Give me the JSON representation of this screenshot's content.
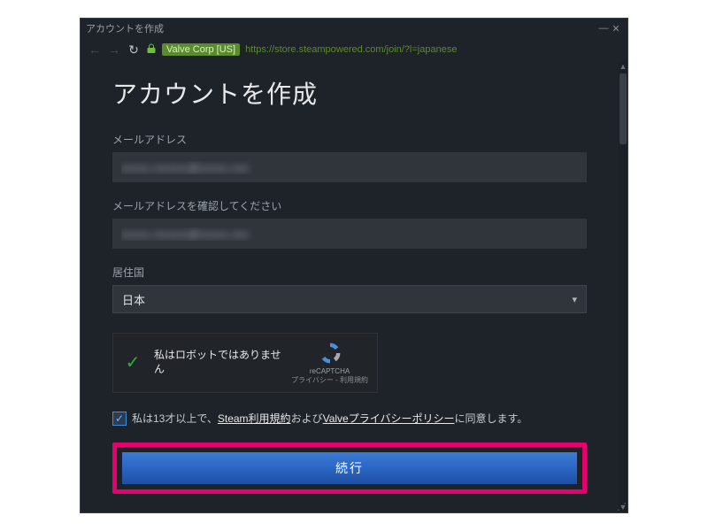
{
  "window": {
    "title": "アカウントを作成"
  },
  "toolbar": {
    "badge": "Valve Corp [US]",
    "url": "https://store.steampowered.com/join/?l=japanese"
  },
  "page": {
    "heading": "アカウントを作成",
    "email_label": "メールアドレス",
    "email_value": "xxxxx.xxxxxx@xxxxx.xxx",
    "confirm_label": "メールアドレスを確認してください",
    "confirm_value": "xxxxx.xxxxxx@xxxxx.xxx",
    "country_label": "居住国",
    "country_value": "日本",
    "recaptcha_text": "私はロボットではありません",
    "recaptcha_brand": "reCAPTCHA",
    "recaptcha_links": "プライバシー - 利用規約",
    "consent_prefix": "私は13才以上で、",
    "consent_link1": "Steam利用規約",
    "consent_mid": "および",
    "consent_link2": "Valveプライバシーポリシー",
    "consent_suffix": "に同意します。",
    "continue_label": "続行"
  }
}
